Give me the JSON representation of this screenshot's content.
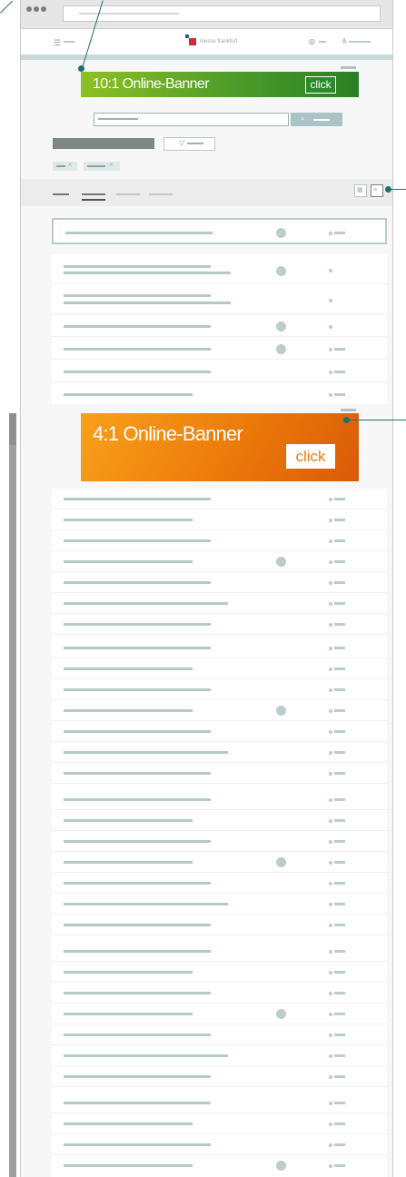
{
  "banners": {
    "top": {
      "title": "10:1 Online-Banner",
      "click": "click"
    },
    "mid": {
      "title": "4:1 Online-Banner",
      "click": "click"
    }
  },
  "header": {
    "logo_text": "messe frankfurt"
  },
  "icons": {
    "menu": "hamburger-icon",
    "search": "search-icon",
    "language": "globe-icon",
    "user": "user-icon",
    "filter": "filter-icon",
    "grid": "grid-view-icon",
    "list": "list-view-icon"
  },
  "colors": {
    "accent": "#a9c3c7",
    "banner_green": "#4d9c2a",
    "banner_orange": "#ee7d0b",
    "callout": "#1f6f6f",
    "logo_red": "#d5263a"
  }
}
